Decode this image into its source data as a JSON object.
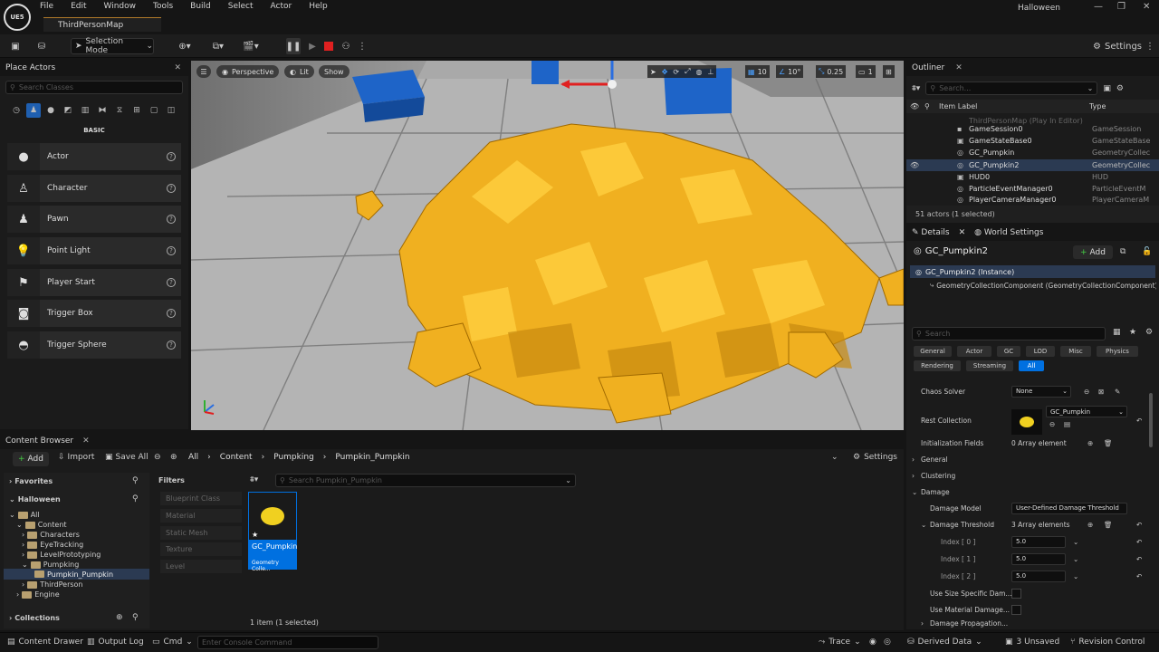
{
  "menubar": {
    "items": [
      "File",
      "Edit",
      "Window",
      "Tools",
      "Build",
      "Select",
      "Actor",
      "Help"
    ],
    "map_tab": "ThirdPersonMap",
    "project": "Halloween",
    "logo_text": "UE5"
  },
  "toolbar": {
    "selection_mode": "Selection Mode",
    "settings": "Settings"
  },
  "place_actors": {
    "title": "Place Actors",
    "search_placeholder": "Search Classes",
    "category": "BASIC",
    "items": [
      {
        "label": "Actor"
      },
      {
        "label": "Character"
      },
      {
        "label": "Pawn"
      },
      {
        "label": "Point Light"
      },
      {
        "label": "Player Start"
      },
      {
        "label": "Trigger Box"
      },
      {
        "label": "Trigger Sphere"
      }
    ]
  },
  "viewport": {
    "perspective": "Perspective",
    "lit": "Lit",
    "show": "Show",
    "grid": "10",
    "angle": "10°",
    "scale": "0.25",
    "camera": "1"
  },
  "outliner": {
    "title": "Outliner",
    "search_placeholder": "Search...",
    "col_label": "Item Label",
    "col_type": "Type",
    "rows": [
      {
        "label": "ThirdPersonMap (Play In Editor)",
        "type": ""
      },
      {
        "label": "GameSession0",
        "type": "GameSession"
      },
      {
        "label": "GameStateBase0",
        "type": "GameStateBase"
      },
      {
        "label": "GC_Pumpkin",
        "type": "GeometryCollec"
      },
      {
        "label": "GC_Pumpkin2",
        "type": "GeometryCollec"
      },
      {
        "label": "HUD0",
        "type": "HUD"
      },
      {
        "label": "ParticleEventManager0",
        "type": "ParticleEventM"
      },
      {
        "label": "PlayerCameraManager0",
        "type": "PlayerCameraM"
      }
    ],
    "status": "51 actors (1 selected)"
  },
  "details": {
    "tab": "Details",
    "world_tab": "World Settings",
    "object": "GC_Pumpkin2",
    "add": "Add",
    "instance": "GC_Pumpkin2 (Instance)",
    "component": "GeometryCollectionComponent (GeometryCollectionComponent)",
    "search_placeholder": "Search",
    "chips_row1": [
      "General",
      "Actor",
      "GC",
      "LOD",
      "Misc",
      "Physics"
    ],
    "chips_row2": [
      "Rendering",
      "Streaming",
      "All"
    ],
    "chaos_solver_label": "Chaos Solver",
    "chaos_solver_value": "None",
    "rest_collection_label": "Rest Collection",
    "rest_collection_value": "GC_Pumpkin",
    "init_fields_label": "Initialization Fields",
    "init_fields_value": "0 Array element",
    "general": "General",
    "clustering": "Clustering",
    "damage": "Damage",
    "damage_model_label": "Damage Model",
    "damage_model_value": "User-Defined Damage Threshold",
    "damage_threshold_label": "Damage Threshold",
    "damage_threshold_value": "3 Array elements",
    "indices": [
      {
        "label": "Index [ 0 ]",
        "value": "5.0"
      },
      {
        "label": "Index [ 1 ]",
        "value": "5.0"
      },
      {
        "label": "Index [ 2 ]",
        "value": "5.0"
      }
    ],
    "size_specific": "Use Size Specific Dam...",
    "use_material": "Use Material Damage...",
    "damage_propagation": "Damage Propagation..."
  },
  "content_browser": {
    "title": "Content Browser",
    "add": "Add",
    "import": "Import",
    "save_all": "Save All",
    "path": [
      "All",
      "Content",
      "Pumpking",
      "Pumpkin_Pumpkin"
    ],
    "settings": "Settings",
    "favorites": "Favorites",
    "project": "Halloween",
    "tree": [
      {
        "label": "All",
        "depth": 0
      },
      {
        "label": "Content",
        "depth": 1
      },
      {
        "label": "Characters",
        "depth": 2
      },
      {
        "label": "EyeTracking",
        "depth": 2
      },
      {
        "label": "LevelPrototyping",
        "depth": 2
      },
      {
        "label": "Pumpking",
        "depth": 2
      },
      {
        "label": "Pumpkin_Pumpkin",
        "depth": 3
      },
      {
        "label": "ThirdPerson",
        "depth": 2
      },
      {
        "label": "Engine",
        "depth": 1
      }
    ],
    "collections": "Collections",
    "filters_title": "Filters",
    "filters": [
      "Blueprint Class",
      "Material",
      "Static Mesh",
      "Texture",
      "Level"
    ],
    "search_placeholder": "Search Pumpkin_Pumpkin",
    "asset_name": "GC_Pumpkin",
    "asset_type": "Geometry Colle...",
    "count": "1 item (1 selected)"
  },
  "statusbar": {
    "drawer": "Content Drawer",
    "output": "Output Log",
    "cmd": "Cmd",
    "console_placeholder": "Enter Console Command",
    "trace": "Trace",
    "derived": "Derived Data",
    "unsaved": "3 Unsaved",
    "revision": "Revision Control"
  },
  "colors": {
    "accent": "#0070e0",
    "selected_row": "#2b3a52",
    "pumpkin": "#f0b020"
  }
}
